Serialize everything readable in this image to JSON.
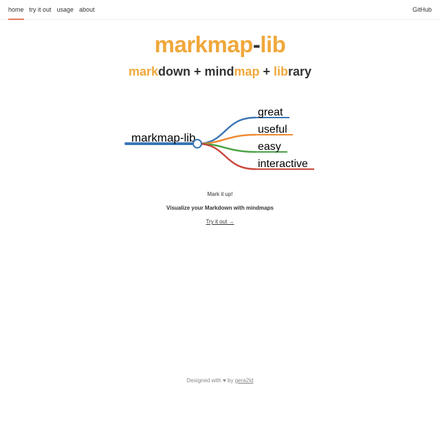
{
  "nav": {
    "links": [
      {
        "label": "home",
        "active": true
      },
      {
        "label": "try it out",
        "active": false
      },
      {
        "label": "usage",
        "active": false
      },
      {
        "label": "about",
        "active": false
      }
    ],
    "github": "GitHub",
    "active_underline_color": "#e07a5f"
  },
  "hero": {
    "brand": {
      "part1": "markmap",
      "dash": "-",
      "part2": "lib"
    },
    "tagline": {
      "t1": "mark",
      "t2": "down",
      "t3": " + mind",
      "t4": "map",
      "t5": " + ",
      "t6": "lib",
      "t7": "rary"
    },
    "accent_color": "#f0a83b"
  },
  "mindmap": {
    "root": {
      "label": "markmap-lib",
      "color": "#3a76b5"
    },
    "children": [
      {
        "label": "great",
        "color": "#3a76b5"
      },
      {
        "label": "useful",
        "color": "#ef8a2f"
      },
      {
        "label": "easy",
        "color": "#4aa143"
      },
      {
        "label": "interactive",
        "color": "#c8473b"
      }
    ]
  },
  "info": {
    "mark_it_up": "Mark it up!",
    "visualize": "Visualize your Markdown with mindmaps",
    "try_link": "Try it out →"
  },
  "footer": {
    "designed_with": "Designed with",
    "heart": "♥",
    "by": "by",
    "author": "gera2ld"
  }
}
